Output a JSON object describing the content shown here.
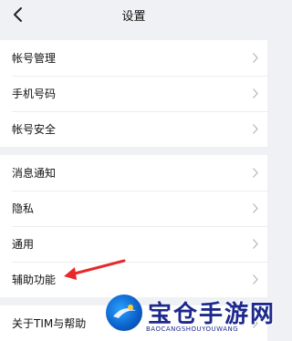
{
  "nav": {
    "title": "设置"
  },
  "groups": [
    {
      "items": [
        {
          "label": "帐号管理"
        },
        {
          "label": "手机号码"
        },
        {
          "label": "帐号安全"
        }
      ]
    },
    {
      "items": [
        {
          "label": "消息通知"
        },
        {
          "label": "隐私"
        },
        {
          "label": "通用"
        },
        {
          "label": "辅助功能"
        }
      ]
    },
    {
      "items": [
        {
          "label": "关于TIM与帮助"
        }
      ]
    }
  ],
  "watermark": {
    "text": "宝仓手游网",
    "sub": "BAOCANGSHOUYOUWANG"
  },
  "colors": {
    "background": "#f0f1f5",
    "row": "#ffffff",
    "annotation_arrow": "#e8282b"
  }
}
